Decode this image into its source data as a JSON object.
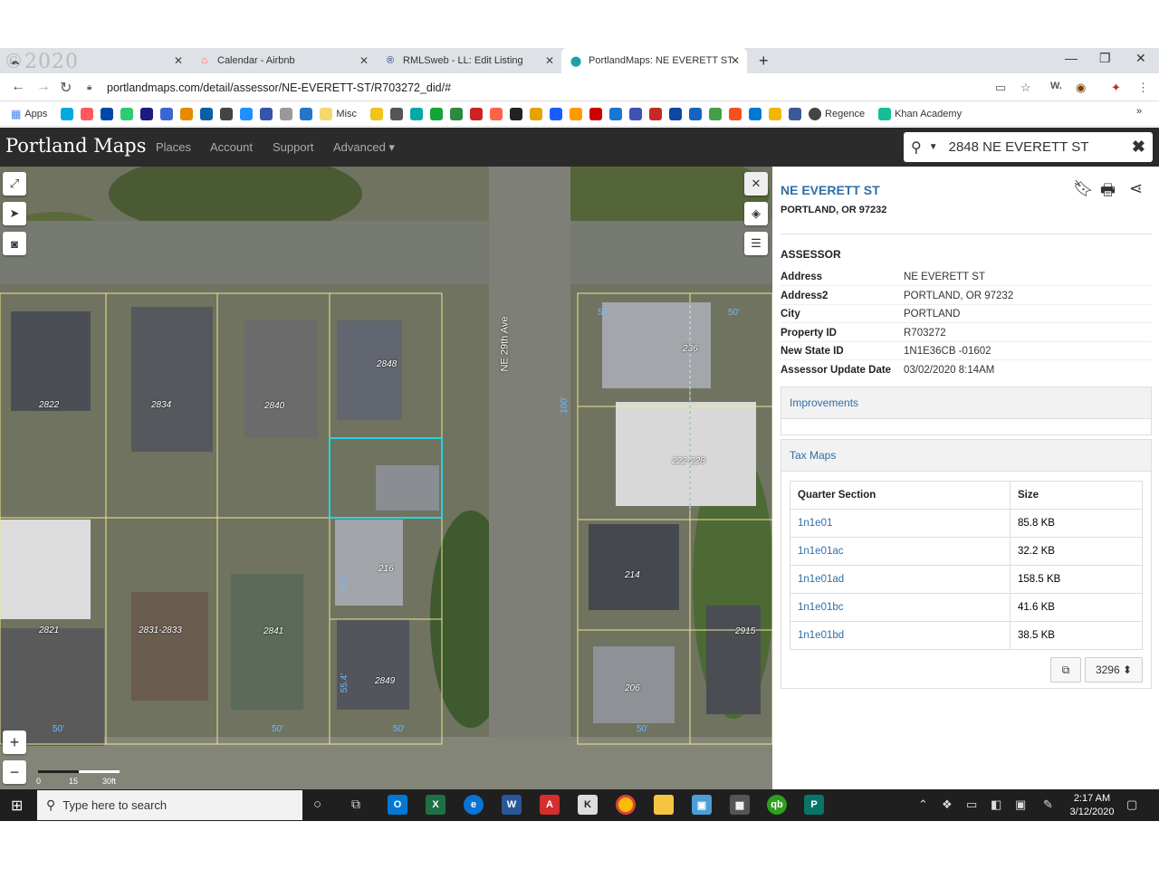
{
  "watermark": "©2020",
  "tabs": [
    {
      "title": "",
      "icon": "cloud-icon",
      "close": "✕"
    },
    {
      "title": "Calendar - Airbnb",
      "icon": "airbnb-icon",
      "close": "✕"
    },
    {
      "title": "RMLSweb - LL: Edit Listing",
      "icon": "rmls-icon",
      "close": "✕"
    },
    {
      "title": "PortlandMaps: NE EVERETT ST",
      "icon": "location-pin-icon",
      "close": "✕"
    }
  ],
  "new_tab": "+",
  "window_controls": {
    "minimize": "—",
    "restore": "❐",
    "close": "✕"
  },
  "address": {
    "url": "portlandmaps.com/detail/assessor/NE-EVERETT-ST/R703272_did/#"
  },
  "bookmarks": {
    "apps_label": "Apps",
    "misc_label": "Misc",
    "regence_label": "Regence",
    "khan_label": "Khan Academy",
    "more": "»",
    "icon_colors": [
      "#00a9e0",
      "#ff5a5f",
      "#0047ab",
      "#2ecc71",
      "#1a1a80",
      "#3a66d4",
      "#e68a00",
      "#0a5fa5",
      "#444",
      "#1e90ff",
      "#3355aa",
      "#999",
      "#2277cc",
      "#f0c419",
      "#555",
      "#0aa",
      "#13a538",
      "#2b8a3e",
      "#cc2222",
      "#ff6347",
      "#222",
      "#e5a300",
      "#1a5cff",
      "#ff9900",
      "#cc0000",
      "#1976d2",
      "#3f51b5",
      "#c62828",
      "#0d47a1",
      "#1565c0",
      "#43a047",
      "#f4511e",
      "#0078d4",
      "#f2b705",
      "#3b5998"
    ]
  },
  "app": {
    "logo": "Portland Maps",
    "nav": [
      "Places",
      "Account",
      "Support",
      "Advanced ▾"
    ],
    "search_value": "2848 NE EVERETT ST",
    "search_clear": "✖"
  },
  "map": {
    "street_label": "NE 29th Ave",
    "lot_labels": [
      "2822",
      "2834",
      "2840",
      "2848",
      "2821",
      "2831-2833",
      "2841",
      "2849",
      "2915",
      "214",
      "206",
      "222-228",
      "236",
      "216"
    ],
    "dim_labels": [
      "50'",
      "100'",
      "44.6'",
      "55.4'",
      "50'",
      "50'",
      "50'",
      "50'",
      "50'"
    ],
    "scale_labels": [
      "0",
      "15",
      "30ft"
    ],
    "zoom_in": "+",
    "zoom_out": "−"
  },
  "detail": {
    "title": "NE EVERETT ST",
    "subtitle": "PORTLAND, OR 97232",
    "section": "ASSESSOR",
    "fields": [
      {
        "k": "Address",
        "v": "NE EVERETT ST"
      },
      {
        "k": "Address2",
        "v": "PORTLAND, OR 97232"
      },
      {
        "k": "City",
        "v": "PORTLAND"
      },
      {
        "k": "Property ID",
        "v": "R703272"
      },
      {
        "k": "New State ID",
        "v": "1N1E36CB -01602"
      },
      {
        "k": "Assessor Update Date",
        "v": "03/02/2020 8:14AM"
      }
    ],
    "improvements_label": "Improvements",
    "taxmaps_label": "Tax Maps",
    "taxmaps_headers": [
      "Quarter Section",
      "Size"
    ],
    "taxmaps_rows": [
      {
        "q": "1n1e01",
        "size": "85.8 KB"
      },
      {
        "q": "1n1e01ac",
        "size": "32.2 KB"
      },
      {
        "q": "1n1e01ad",
        "size": "158.5 KB"
      },
      {
        "q": "1n1e01bc",
        "size": "41.6 KB"
      },
      {
        "q": "1n1e01bd",
        "size": "38.5 KB"
      }
    ],
    "taxmaps_select": "3296 ⬍"
  },
  "taskbar": {
    "search_placeholder": "Type here to search",
    "time": "2:17 AM",
    "date": "3/12/2020"
  }
}
